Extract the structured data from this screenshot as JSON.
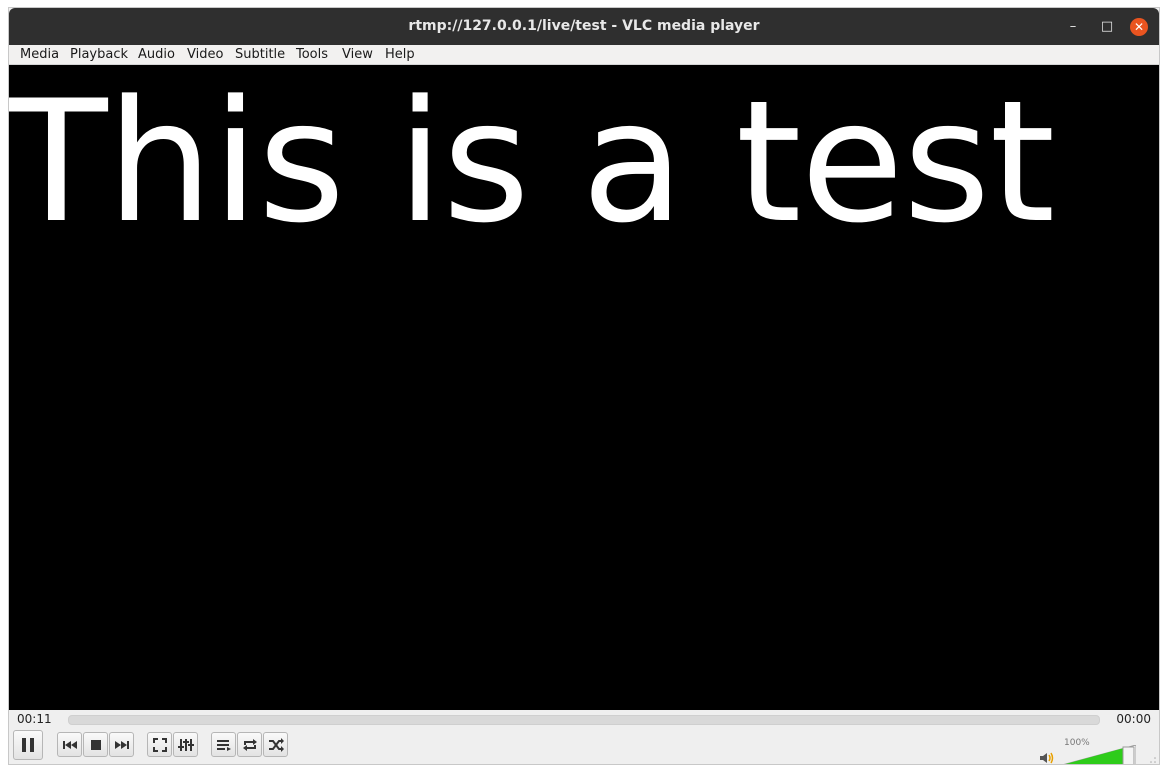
{
  "window": {
    "title": "rtmp://127.0.0.1/live/test - VLC media player",
    "controls": {
      "minimize": "–",
      "maximize": "□",
      "close": "✕"
    }
  },
  "menu": {
    "items": [
      "Media",
      "Playback",
      "Audio",
      "Video",
      "Subtitle",
      "Tools",
      "View",
      "Help"
    ]
  },
  "video": {
    "text": "This is a test",
    "background": "#000000",
    "text_color": "#ffffff"
  },
  "seek": {
    "elapsed": "00:11",
    "total": "00:00"
  },
  "controls": {
    "buttons": [
      "pause-icon",
      "previous-icon",
      "stop-icon",
      "next-icon",
      "fullscreen-icon",
      "extended-settings-icon",
      "playlist-icon",
      "loop-icon",
      "shuffle-icon"
    ]
  },
  "volume": {
    "label": "100%",
    "level": 1.0,
    "accent": "#2ecc1a"
  },
  "colors": {
    "titlebar": "#2f2f2f",
    "close_button": "#e95420"
  }
}
